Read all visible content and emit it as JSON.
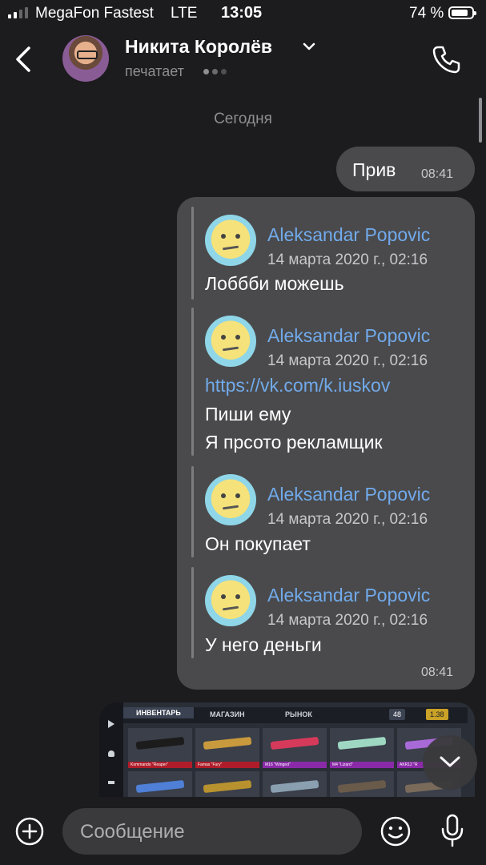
{
  "status_bar": {
    "carrier": "MegaFon Fastest",
    "network": "LTE",
    "time": "13:05",
    "battery": "74 %"
  },
  "header": {
    "name": "Никита Королёв",
    "status": "печатает",
    "icons": [
      "back-icon",
      "chevron-down-icon",
      "phone-icon"
    ]
  },
  "chat": {
    "date_label": "Сегодня",
    "messages": [
      {
        "text": "Прив",
        "time": "08:41"
      }
    ],
    "forwarded_group": {
      "time": "08:41",
      "items": [
        {
          "author": "Aleksandar Popovic",
          "date": "14 марта 2020 г., 02:16",
          "lines": [
            "Лоббби можешь"
          ]
        },
        {
          "author": "Aleksandar Popovic",
          "date": "14 марта 2020 г., 02:16",
          "link": "https://vk.com/k.iuskov",
          "lines": [
            "Пиши ему",
            "Я прсото рекламщик"
          ]
        },
        {
          "author": "Aleksandar Popovic",
          "date": "14 марта 2020 г., 02:16",
          "lines": [
            "Он покупает"
          ]
        },
        {
          "author": "Aleksandar Popovic",
          "date": "14 марта 2020 г., 02:16",
          "lines": [
            "У него деньги"
          ]
        }
      ]
    },
    "image_message": {
      "tabs": [
        "ИНВЕНТАРЬ",
        "МАГАЗИН",
        "РЫНОК"
      ],
      "counters": [
        "48",
        "1.38"
      ],
      "item_labels": [
        "Kommando \"Reaper\"",
        "Famas \"Fury\"",
        "M16 \"Winged\"",
        "M4 \"Lizard\"",
        "AKR12 \"R"
      ]
    }
  },
  "input": {
    "placeholder": "Сообщение"
  }
}
